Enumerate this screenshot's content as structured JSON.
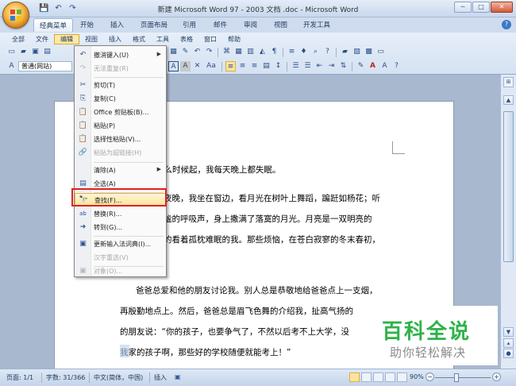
{
  "window": {
    "title": "新建 Microsoft Word 97 - 2003 文档 .doc - Microsoft Word",
    "minimize": "─",
    "maximize": "□",
    "close": "✕"
  },
  "quick_access": {
    "save": "💾",
    "undo": "↶",
    "redo": "↷"
  },
  "ribbon_tabs": [
    {
      "label": "经典菜单",
      "active": true
    },
    {
      "label": "开始"
    },
    {
      "label": "插入"
    },
    {
      "label": "页面布局"
    },
    {
      "label": "引用"
    },
    {
      "label": "邮件"
    },
    {
      "label": "审阅"
    },
    {
      "label": "视图"
    },
    {
      "label": "开发工具"
    }
  ],
  "help": "?",
  "classic_menu": [
    "全部",
    "文件",
    "编辑",
    "视图",
    "插入",
    "格式",
    "工具",
    "表格",
    "窗口",
    "帮助"
  ],
  "classic_menu_open": "编辑",
  "style_combo": "普通(网站)",
  "font_combo_arrow": "▾",
  "format_buttons": {
    "italic": "I",
    "underline": "U",
    "char_border": "A",
    "char_shading": "A",
    "font_size_label": "Aa"
  },
  "edit_menu": {
    "items": [
      {
        "label": "撤消键入(U)",
        "icon": "undo-icon",
        "glyph": "↶",
        "submenu": true
      },
      {
        "label": "无法重复(R)",
        "icon": "redo-icon",
        "glyph": "↷",
        "disabled": true
      },
      {
        "label": "剪切(T)",
        "icon": "scissors-icon",
        "glyph": "✂"
      },
      {
        "label": "复制(C)",
        "icon": "copy-icon",
        "glyph": "⎘"
      },
      {
        "label": "Office 剪贴板(B)...",
        "icon": "clipboard-icon",
        "glyph": "📋"
      },
      {
        "label": "粘贴(P)",
        "icon": "paste-icon",
        "glyph": "📋"
      },
      {
        "label": "选择性粘贴(V)...",
        "icon": "paste-special-icon",
        "glyph": "📋"
      },
      {
        "label": "粘贴为超链接(H)",
        "icon": "paste-link-icon",
        "glyph": "🔗",
        "disabled": true
      },
      {
        "label": "清除(A)",
        "icon": "",
        "glyph": "",
        "submenu": true
      },
      {
        "label": "全选(A)",
        "icon": "select-all-icon",
        "glyph": "▤"
      },
      {
        "label": "查找(F)...",
        "icon": "binoculars-icon",
        "glyph": "🔭",
        "highlighted": true
      },
      {
        "label": "替换(R)...",
        "icon": "replace-icon",
        "glyph": "ab"
      },
      {
        "label": "转到(G)...",
        "icon": "goto-arrow-icon",
        "glyph": "➜"
      },
      {
        "label": "更新输入法词典(I)...",
        "icon": "ime-dictionary-icon",
        "glyph": "▣"
      },
      {
        "label": "汉字重选(V)",
        "icon": "",
        "glyph": "",
        "disabled": true
      },
      {
        "label": "对象(O)...",
        "icon": "object-icon",
        "glyph": "▣",
        "disabled": true
      }
    ]
  },
  "document_lines": [
    "什么时候起，我每天晚上都失眠。",
    "夜晚，我坐在窗边，看月光在树叶上舞蹈，蹁跹如杨花；听",
    "谧的呼吸声，身上撒满了落寞的月光。月亮是一双明亮的",
    "的看着孤枕难眠的我。那些烦恼，在苍白寂寥的冬末春初，",
    "",
    "爸爸总爱和他的朋友讨论我。别人总是恭敬地给爸爸点上一支烟，",
    "再殷勤地点上。然后，爸爸总是眉飞色舞的介绍我，扯高气扬的",
    "的朋友说：“你的孩子，也要争气了，不然以后考不上大学，没",
    "我家的孩子啊，那些好的学校随便就能考上！”"
  ],
  "status": {
    "page": "页面: 1/1",
    "words": "字数: 31/366",
    "language": "中文(简体，中国)",
    "mode": "插入",
    "zoom": "90%",
    "zoom_minus": "−",
    "zoom_plus": "+"
  },
  "watermark": {
    "title": "百科全说",
    "subtitle": "助你轻松解决"
  },
  "colors": {
    "accent": "#2db34a",
    "highlight_border": "#e02020",
    "menu_hover": "#fde49a"
  }
}
